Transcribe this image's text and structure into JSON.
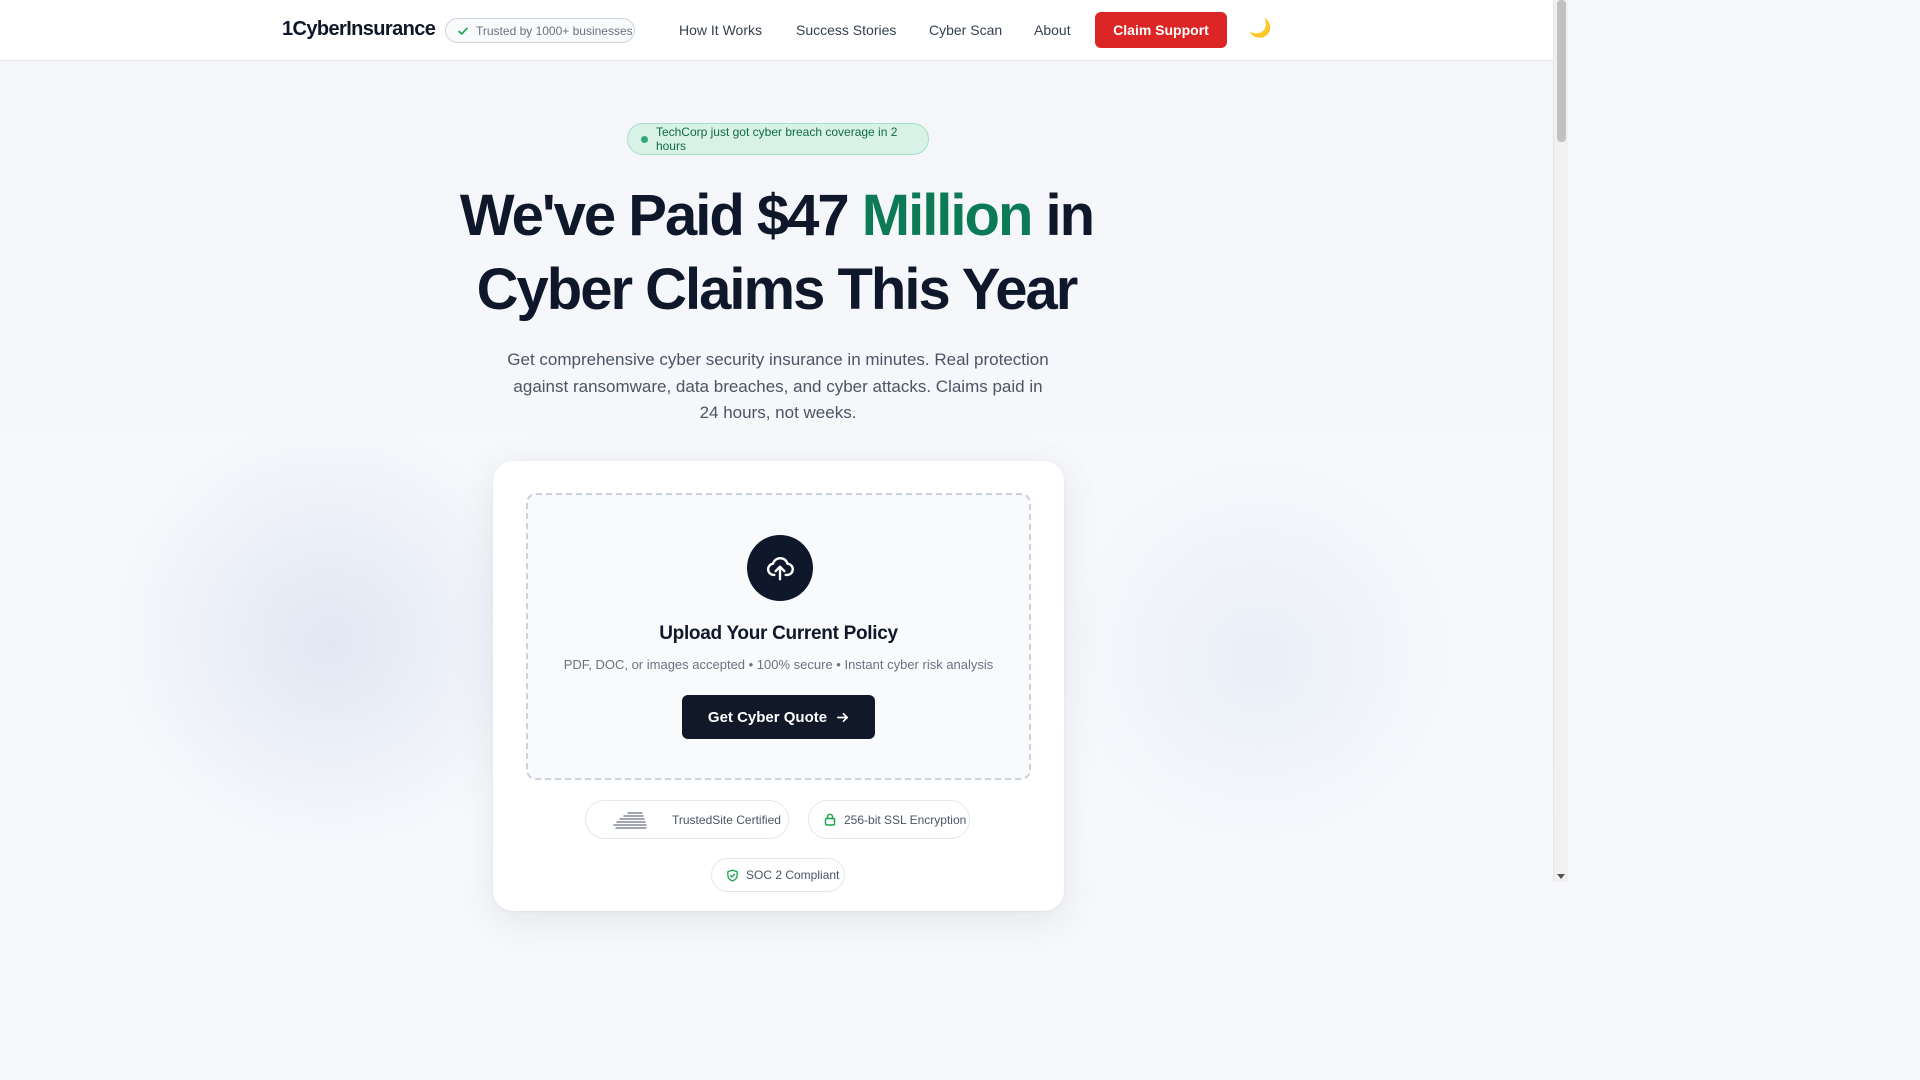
{
  "nav": {
    "logo": "1CyberInsurance",
    "trust_badge": "Trusted by 1000+ businesses",
    "links": [
      "How It Works",
      "Success Stories",
      "Cyber Scan",
      "About"
    ],
    "cta": "Claim Support",
    "theme_toggle": "🌙"
  },
  "hero": {
    "news": "TechCorp just got cyber breach coverage in 2 hours",
    "headline_part1": "We've Paid $47 ",
    "headline_accent": "Million",
    "headline_part2": " in",
    "headline_line2": "Cyber Claims This Year",
    "subtext": "Get comprehensive cyber security insurance in minutes. Real protection against ransomware, data breaches, and cyber attacks. Claims paid in 24 hours, not weeks."
  },
  "upload": {
    "title": "Upload Your Current Policy",
    "subtitle": "PDF, DOC, or images accepted • 100% secure • Instant cyber risk analysis",
    "button": "Get Cyber Quote"
  },
  "badges": {
    "trusted": "TrustedSite Certified",
    "ssl": "256-bit SSL Encryption",
    "soc": "SOC 2 Compliant"
  },
  "colors": {
    "brand_dark": "#0f172a",
    "accent_green": "#0b7a55",
    "cta_red": "#dc2626"
  }
}
